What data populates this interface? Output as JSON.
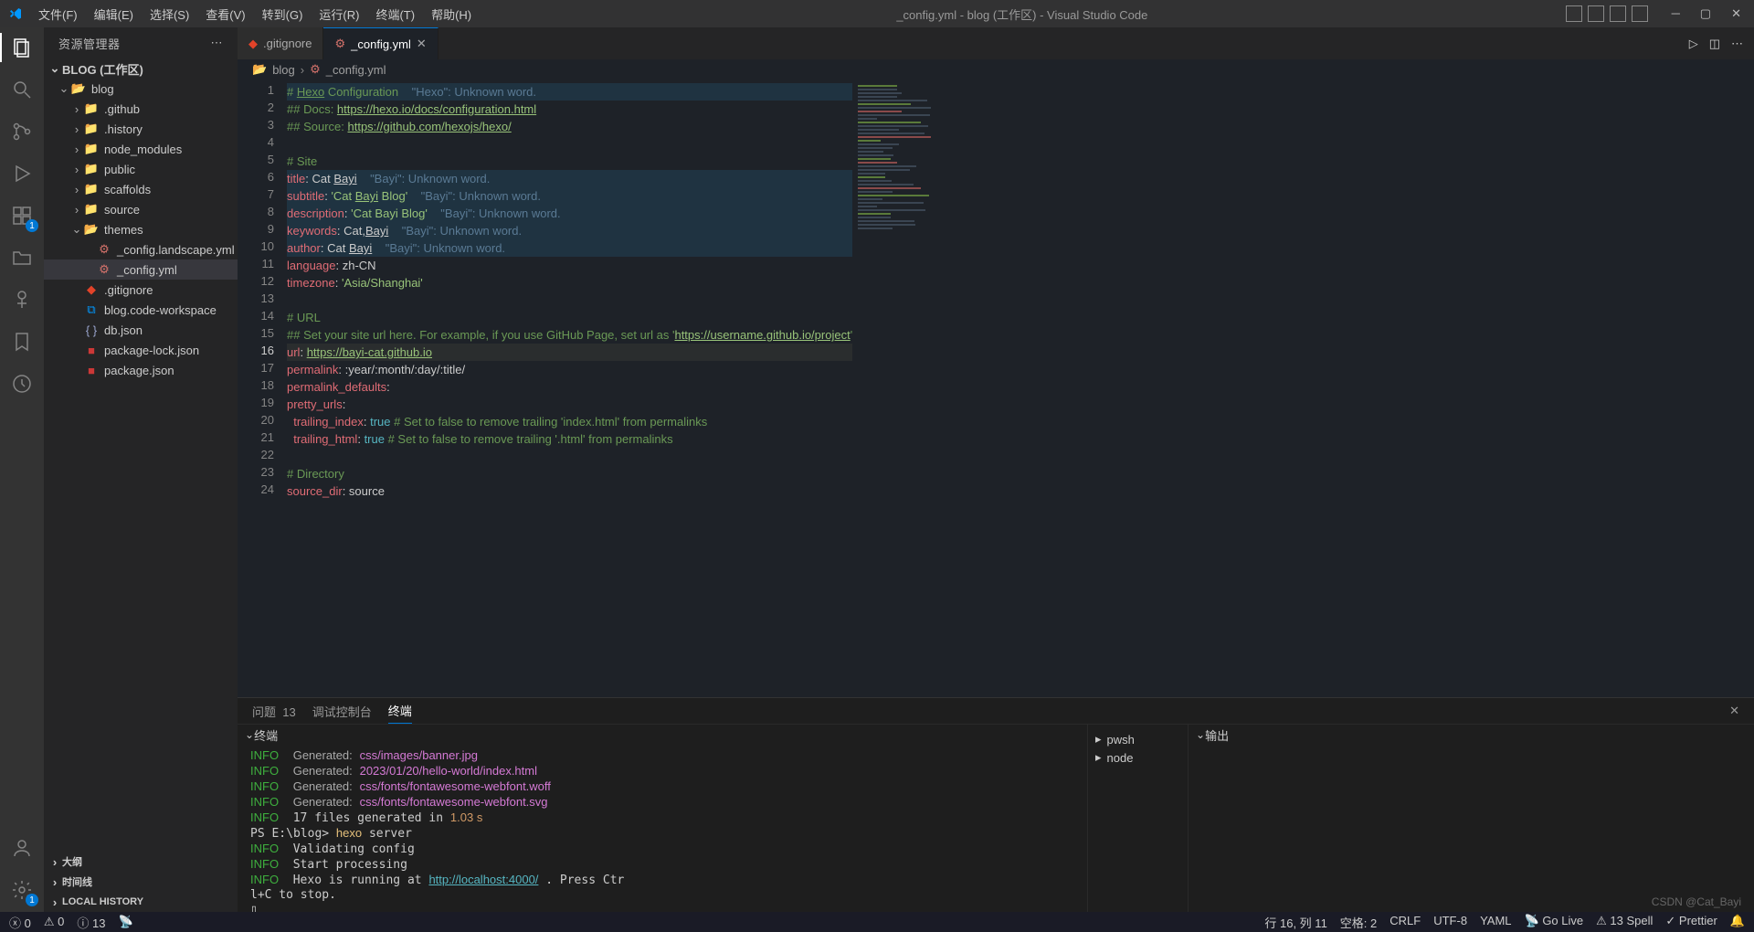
{
  "window": {
    "title": "_config.yml - blog (工作区) - Visual Studio Code"
  },
  "menu": [
    "文件(F)",
    "编辑(E)",
    "选择(S)",
    "查看(V)",
    "转到(G)",
    "运行(R)",
    "终端(T)",
    "帮助(H)"
  ],
  "activity": {
    "ext_badge": "1",
    "settings_badge": "1"
  },
  "sidebar": {
    "title": "资源管理器",
    "workspace": "BLOG (工作区)",
    "tree": [
      {
        "d": 1,
        "type": "folder-open",
        "label": "blog"
      },
      {
        "d": 2,
        "type": "folder",
        "label": ".github"
      },
      {
        "d": 2,
        "type": "folder",
        "label": ".history"
      },
      {
        "d": 2,
        "type": "folder",
        "label": "node_modules"
      },
      {
        "d": 2,
        "type": "folder",
        "label": "public"
      },
      {
        "d": 2,
        "type": "folder",
        "label": "scaffolds"
      },
      {
        "d": 2,
        "type": "folder",
        "label": "source"
      },
      {
        "d": 2,
        "type": "folder-open",
        "label": "themes"
      },
      {
        "d": 3,
        "type": "yaml",
        "label": "_config.landscape.yml"
      },
      {
        "d": 3,
        "type": "yaml",
        "label": "_config.yml",
        "sel": true
      },
      {
        "d": 2,
        "type": "gitignore",
        "label": ".gitignore"
      },
      {
        "d": 2,
        "type": "code",
        "label": "blog.code-workspace"
      },
      {
        "d": 2,
        "type": "json",
        "label": "db.json"
      },
      {
        "d": 2,
        "type": "npm",
        "label": "package-lock.json"
      },
      {
        "d": 2,
        "type": "npm",
        "label": "package.json"
      }
    ],
    "sections": [
      "大纲",
      "时间线",
      "LOCAL HISTORY"
    ]
  },
  "tabs": [
    {
      "icon": "gitignore",
      "label": ".gitignore"
    },
    {
      "icon": "yaml",
      "label": "_config.yml",
      "active": true
    }
  ],
  "breadcrumb": [
    "blog",
    "_config.yml"
  ],
  "code": {
    "lines": [
      {
        "n": 1,
        "hl": true,
        "html": "<span class='cl-cm'># <u>Hexo</u> Configuration</span>    <span class='hint'>\"Hexo\": Unknown word.</span>"
      },
      {
        "n": 2,
        "html": "<span class='cl-cm'>## Docs: </span><span class='cl-link'>https://hexo.io/docs/configuration.html</span>"
      },
      {
        "n": 3,
        "html": "<span class='cl-cm'>## Source: </span><span class='cl-link'>https://github.com/hexojs/hexo/</span>"
      },
      {
        "n": 4,
        "html": ""
      },
      {
        "n": 5,
        "html": "<span class='cl-cm'># Site</span>"
      },
      {
        "n": 6,
        "hl": true,
        "html": "<span class='cl-key'>title</span>: Cat <u>Bayi</u>    <span class='hint'>\"Bayi\": Unknown word.</span>"
      },
      {
        "n": 7,
        "hl": true,
        "html": "<span class='cl-key'>subtitle</span>: <span class='cl-str'>'Cat <u>Bayi</u> Blog'</span>    <span class='hint'>\"Bayi\": Unknown word.</span>"
      },
      {
        "n": 8,
        "hl": true,
        "html": "<span class='cl-key'>description</span>: <span class='cl-str'>'Cat Bayi Blog'</span>    <span class='hint'>\"Bayi\": Unknown word.</span>"
      },
      {
        "n": 9,
        "hl": true,
        "html": "<span class='cl-key'>keywords</span>: Cat,<u>Bayi</u>    <span class='hint'>\"Bayi\": Unknown word.</span>"
      },
      {
        "n": 10,
        "hl": true,
        "html": "<span class='cl-key'>author</span>: Cat <u>Bayi</u>    <span class='hint'>\"Bayi\": Unknown word.</span>"
      },
      {
        "n": 11,
        "html": "<span class='cl-key'>language</span>: zh-CN"
      },
      {
        "n": 12,
        "html": "<span class='cl-key'>timezone</span>: <span class='cl-str'>'Asia/Shanghai'</span>"
      },
      {
        "n": 13,
        "html": ""
      },
      {
        "n": 14,
        "html": "<span class='cl-cm'># URL</span>"
      },
      {
        "n": 15,
        "html": "<span class='cl-cm'>## Set your site url here. For example, if you use GitHub Page, set url as '</span><span class='cl-link'>https://username.github.io/project</span><span class='cl-cm'>'</span>"
      },
      {
        "n": 16,
        "cur": true,
        "html": "<span class='cl-key'>url</span>: <span class='cl-link'>https://bayi-cat.github.io</span>"
      },
      {
        "n": 17,
        "html": "<span class='cl-key'>permalink</span>: :year/:month/:day/:title/"
      },
      {
        "n": 18,
        "html": "<span class='cl-key'>permalink_defaults</span>:"
      },
      {
        "n": 19,
        "html": "<span class='cl-key'>pretty_urls</span>:"
      },
      {
        "n": 20,
        "html": "  <span class='cl-key'>trailing_index</span>: <span class='cl-bool'>true</span> <span class='cl-cm'># Set to false to remove trailing 'index.html' from permalinks</span>"
      },
      {
        "n": 21,
        "html": "  <span class='cl-key'>trailing_html</span>: <span class='cl-bool'>true</span> <span class='cl-cm'># Set to false to remove trailing '.html' from permalinks</span>"
      },
      {
        "n": 22,
        "html": ""
      },
      {
        "n": 23,
        "html": "<span class='cl-cm'># Directory</span>"
      },
      {
        "n": 24,
        "html": "<span class='cl-key'>source_dir</span>: source"
      }
    ]
  },
  "panel": {
    "tabs": {
      "problems": "问题",
      "problems_count": "13",
      "debug": "调试控制台",
      "terminal": "终端"
    },
    "terminal_label": "终端",
    "output_label": "输出",
    "terminal": [
      "<span class='t-info'>INFO</span>  <span class='t-gen'>Generated:</span> <span class='t-path'>css/images/banner.jpg</span>",
      "<span class='t-info'>INFO</span>  <span class='t-gen'>Generated:</span> <span class='t-path'>2023/01/20/hello-world/index.html</span>",
      "<span class='t-info'>INFO</span>  <span class='t-gen'>Generated:</span> <span class='t-path'>css/fonts/fontawesome-webfont.woff</span>",
      "<span class='t-info'>INFO</span>  <span class='t-gen'>Generated:</span> <span class='t-path'>css/fonts/fontawesome-webfont.svg</span>",
      "<span class='t-info'>INFO</span>  17 files generated in <span class='t-num'>1.03 s</span>",
      "PS E:\\blog> <span style='color:#e5c07b'>hexo</span> server",
      "<span class='t-info'>INFO</span>  Validating config",
      "<span class='t-info'>INFO</span>  Start processing",
      "<span class='t-info'>INFO</span>  Hexo is running at <span class='t-link'>http://localhost:4000/</span> . Press Ctr",
      "l+C to stop.",
      "▯"
    ],
    "shells": [
      "pwsh",
      "node"
    ]
  },
  "status": {
    "left": {
      "errors": "0",
      "warnings": "0",
      "info": "13"
    },
    "right": {
      "pos": "行 16, 列 11",
      "spaces": "空格: 2",
      "eol": "CRLF",
      "enc": "UTF-8",
      "lang": "YAML",
      "golive": "Go Live",
      "spell": "13 Spell",
      "prettier": "Prettier",
      "notif": ""
    }
  },
  "watermark": "CSDN @Cat_Bayi"
}
